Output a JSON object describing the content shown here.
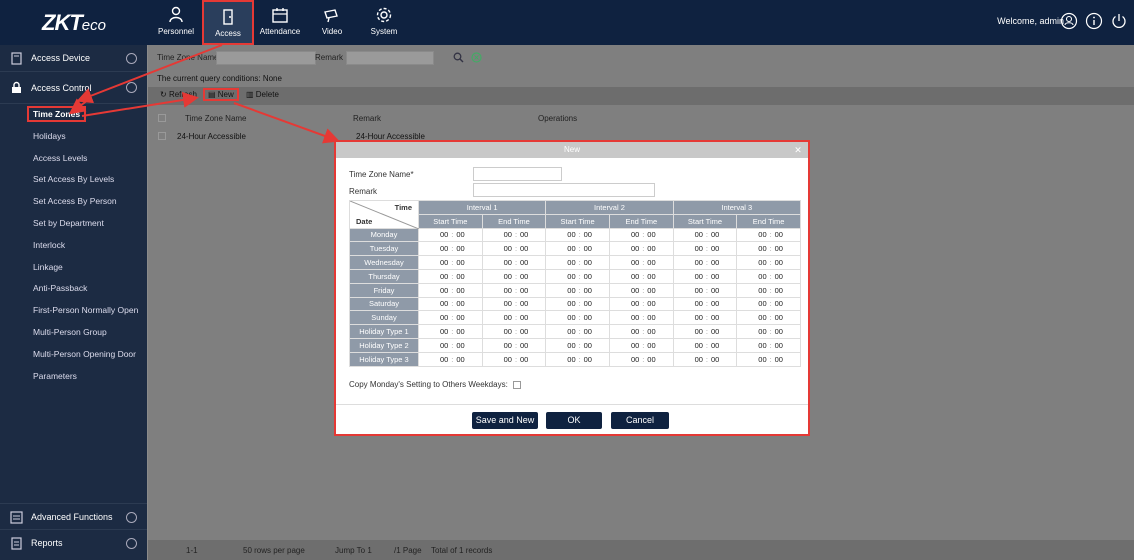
{
  "brand": {
    "logo_main": "ZKT",
    "logo_sub": "eco"
  },
  "nav": [
    {
      "label": "Personnel",
      "icon": "personnel-icon"
    },
    {
      "label": "Access",
      "icon": "access-icon",
      "active": true
    },
    {
      "label": "Attendance",
      "icon": "attendance-icon"
    },
    {
      "label": "Video",
      "icon": "video-icon"
    },
    {
      "label": "System",
      "icon": "system-icon"
    }
  ],
  "header": {
    "welcome": "Welcome, admin"
  },
  "sidebar": {
    "group_device": "Access Device",
    "group_control": "Access Control",
    "items": [
      "Time Zones",
      "Holidays",
      "Access Levels",
      "Set Access By Levels",
      "Set Access By Person",
      "Set by Department",
      "Interlock",
      "Linkage",
      "Anti-Passback",
      "First-Person Normally Open",
      "Multi-Person Group",
      "Multi-Person Opening Door",
      "Parameters"
    ],
    "active_item": "Time Zones",
    "group_advanced": "Advanced Functions",
    "group_reports": "Reports"
  },
  "query": {
    "tz_label": "Time Zone Name",
    "remark_label": "Remark",
    "conditions": "The current query conditions: None"
  },
  "toolbar": {
    "refresh": "Refresh",
    "new": "New",
    "delete": "Delete"
  },
  "table": {
    "headers": [
      "Time Zone Name",
      "Remark",
      "Operations"
    ],
    "rows": [
      {
        "name": "24-Hour Accessible",
        "remark": "24-Hour Accessible"
      }
    ]
  },
  "pager": {
    "pages": "1-1",
    "per_page": "50 rows per page",
    "jump": "Jump To 1",
    "page_of": "/1 Page",
    "total": "Total of 1 records"
  },
  "dialog": {
    "title": "New",
    "tz_name_label": "Time Zone Name*",
    "remark_label": "Remark",
    "corner_time": "Time",
    "corner_date": "Date",
    "intervals": [
      "Interval 1",
      "Interval 2",
      "Interval 3"
    ],
    "start_label": "Start Time",
    "end_label": "End Time",
    "days": [
      "Monday",
      "Tuesday",
      "Wednesday",
      "Thursday",
      "Friday",
      "Saturday",
      "Sunday",
      "Holiday Type 1",
      "Holiday Type 2",
      "Holiday Type 3"
    ],
    "time_hour": "00",
    "time_min": "00",
    "copy_label": "Copy Monday's Setting to Others Weekdays:",
    "buttons": {
      "save_new": "Save and New",
      "ok": "OK",
      "cancel": "Cancel"
    }
  }
}
